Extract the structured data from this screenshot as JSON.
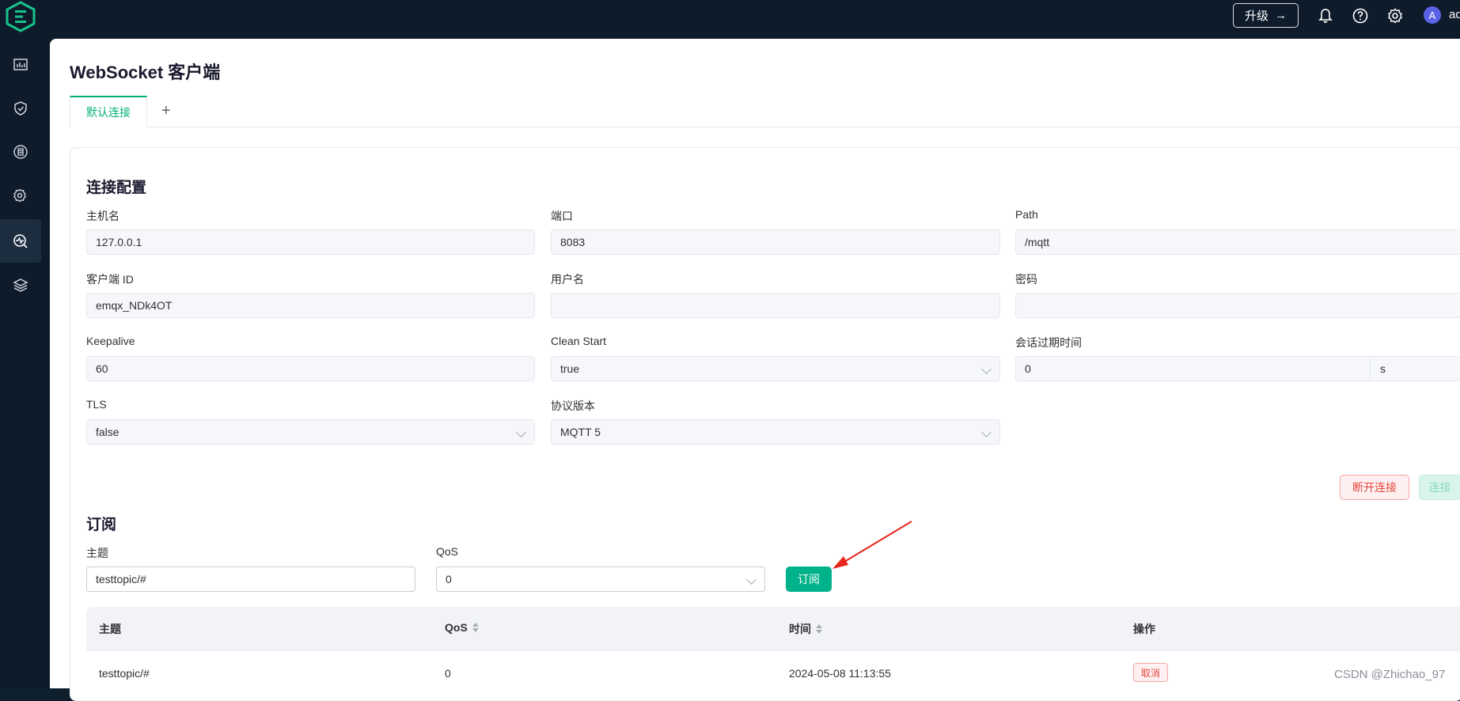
{
  "header": {
    "upgrade_label": "升级",
    "user_initial": "A",
    "user_name": "ad"
  },
  "sidebar": {
    "items": [
      {
        "icon": "dashboard-icon"
      },
      {
        "icon": "shield-check-icon"
      },
      {
        "icon": "data-integration-icon"
      },
      {
        "icon": "management-gear-icon"
      },
      {
        "icon": "diagnose-icon",
        "active": true
      },
      {
        "icon": "layers-icon"
      }
    ]
  },
  "page": {
    "title": "WebSocket 客户端",
    "tabs": [
      {
        "label": "默认连接"
      }
    ],
    "add_tab": "+"
  },
  "connection": {
    "title": "连接配置",
    "host_label": "主机名",
    "host_value": "127.0.0.1",
    "port_label": "端口",
    "port_value": "8083",
    "path_label": "Path",
    "path_value": "/mqtt",
    "client_id_label": "客户端 ID",
    "client_id_value": "emqx_NDk4OT",
    "username_label": "用户名",
    "username_value": "",
    "password_label": "密码",
    "password_value": "",
    "keepalive_label": "Keepalive",
    "keepalive_value": "60",
    "clean_start_label": "Clean Start",
    "clean_start_value": "true",
    "session_expiry_label": "会话过期时间",
    "session_expiry_value": "0",
    "session_expiry_unit": "s",
    "tls_label": "TLS",
    "tls_value": "false",
    "protocol_label": "协议版本",
    "protocol_value": "MQTT 5",
    "disconnect_label": "断开连接",
    "connect_label": "连接"
  },
  "subscribe": {
    "title": "订阅",
    "topic_label": "主题",
    "topic_value": "testtopic/#",
    "qos_label": "QoS",
    "qos_value": "0",
    "subscribe_label": "订阅"
  },
  "table": {
    "columns": [
      "主题",
      "QoS",
      "时间",
      "操作"
    ],
    "rows": [
      {
        "topic": "testtopic/#",
        "qos": "0",
        "time": "2024-05-08 11:13:55",
        "action": "取消"
      }
    ]
  },
  "watermark": "CSDN @Zhichao_97",
  "colors": {
    "brand": "#00b38a",
    "danger": "#e5473d",
    "nav_bg": "#0e1b2b"
  }
}
